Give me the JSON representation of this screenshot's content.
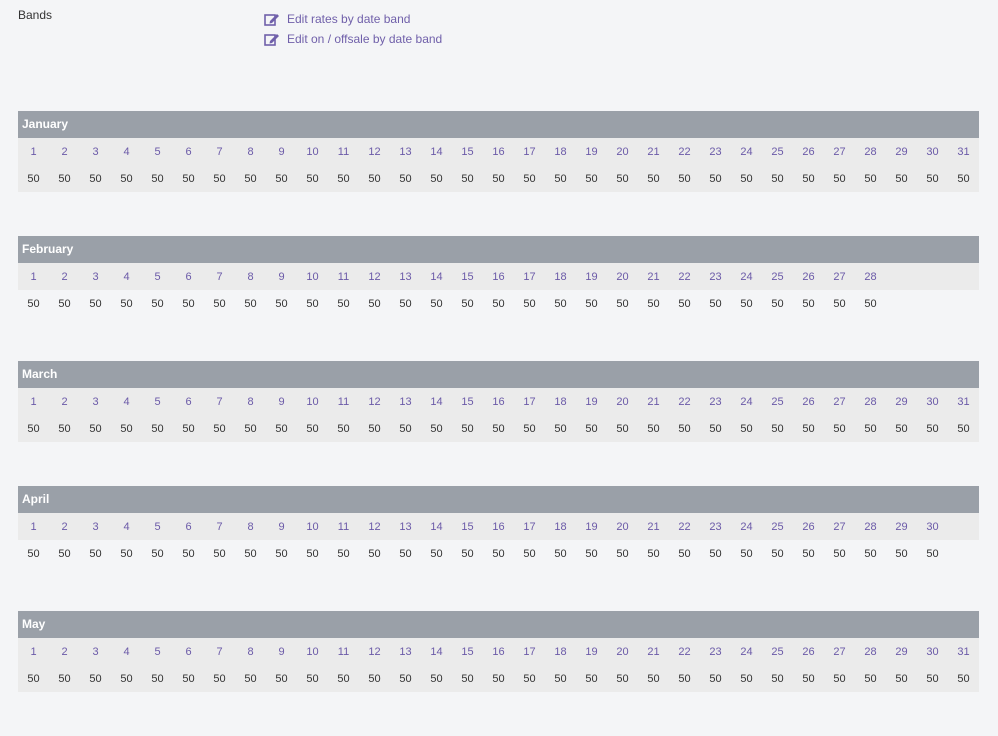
{
  "bands": {
    "label": "Bands",
    "links": [
      {
        "label": "Edit rates by date band",
        "icon": "edit-icon"
      },
      {
        "label": "Edit on / offsale by date band",
        "icon": "edit-icon"
      }
    ]
  },
  "colors": {
    "accent": "#7060aa",
    "header_bg": "#9aa0a8",
    "row_bg": "#ebebeb",
    "page_bg": "#f4f5f7"
  },
  "months": [
    {
      "name": "January",
      "days": [
        "1",
        "2",
        "3",
        "4",
        "5",
        "6",
        "7",
        "8",
        "9",
        "10",
        "11",
        "12",
        "13",
        "14",
        "15",
        "16",
        "17",
        "18",
        "19",
        "20",
        "21",
        "22",
        "23",
        "24",
        "25",
        "26",
        "27",
        "28",
        "29",
        "30",
        "31"
      ],
      "rates": [
        "50",
        "50",
        "50",
        "50",
        "50",
        "50",
        "50",
        "50",
        "50",
        "50",
        "50",
        "50",
        "50",
        "50",
        "50",
        "50",
        "50",
        "50",
        "50",
        "50",
        "50",
        "50",
        "50",
        "50",
        "50",
        "50",
        "50",
        "50",
        "50",
        "50",
        "50"
      ]
    },
    {
      "name": "February",
      "days": [
        "1",
        "2",
        "3",
        "4",
        "5",
        "6",
        "7",
        "8",
        "9",
        "10",
        "11",
        "12",
        "13",
        "14",
        "15",
        "16",
        "17",
        "18",
        "19",
        "20",
        "21",
        "22",
        "23",
        "24",
        "25",
        "26",
        "27",
        "28"
      ],
      "rates": [
        "50",
        "50",
        "50",
        "50",
        "50",
        "50",
        "50",
        "50",
        "50",
        "50",
        "50",
        "50",
        "50",
        "50",
        "50",
        "50",
        "50",
        "50",
        "50",
        "50",
        "50",
        "50",
        "50",
        "50",
        "50",
        "50",
        "50",
        "50"
      ]
    },
    {
      "name": "March",
      "days": [
        "1",
        "2",
        "3",
        "4",
        "5",
        "6",
        "7",
        "8",
        "9",
        "10",
        "11",
        "12",
        "13",
        "14",
        "15",
        "16",
        "17",
        "18",
        "19",
        "20",
        "21",
        "22",
        "23",
        "24",
        "25",
        "26",
        "27",
        "28",
        "29",
        "30",
        "31"
      ],
      "rates": [
        "50",
        "50",
        "50",
        "50",
        "50",
        "50",
        "50",
        "50",
        "50",
        "50",
        "50",
        "50",
        "50",
        "50",
        "50",
        "50",
        "50",
        "50",
        "50",
        "50",
        "50",
        "50",
        "50",
        "50",
        "50",
        "50",
        "50",
        "50",
        "50",
        "50",
        "50"
      ]
    },
    {
      "name": "April",
      "days": [
        "1",
        "2",
        "3",
        "4",
        "5",
        "6",
        "7",
        "8",
        "9",
        "10",
        "11",
        "12",
        "13",
        "14",
        "15",
        "16",
        "17",
        "18",
        "19",
        "20",
        "21",
        "22",
        "23",
        "24",
        "25",
        "26",
        "27",
        "28",
        "29",
        "30"
      ],
      "rates": [
        "50",
        "50",
        "50",
        "50",
        "50",
        "50",
        "50",
        "50",
        "50",
        "50",
        "50",
        "50",
        "50",
        "50",
        "50",
        "50",
        "50",
        "50",
        "50",
        "50",
        "50",
        "50",
        "50",
        "50",
        "50",
        "50",
        "50",
        "50",
        "50",
        "50"
      ]
    },
    {
      "name": "May",
      "days": [
        "1",
        "2",
        "3",
        "4",
        "5",
        "6",
        "7",
        "8",
        "9",
        "10",
        "11",
        "12",
        "13",
        "14",
        "15",
        "16",
        "17",
        "18",
        "19",
        "20",
        "21",
        "22",
        "23",
        "24",
        "25",
        "26",
        "27",
        "28",
        "29",
        "30",
        "31"
      ],
      "rates": [
        "50",
        "50",
        "50",
        "50",
        "50",
        "50",
        "50",
        "50",
        "50",
        "50",
        "50",
        "50",
        "50",
        "50",
        "50",
        "50",
        "50",
        "50",
        "50",
        "50",
        "50",
        "50",
        "50",
        "50",
        "50",
        "50",
        "50",
        "50",
        "50",
        "50",
        "50"
      ]
    }
  ]
}
